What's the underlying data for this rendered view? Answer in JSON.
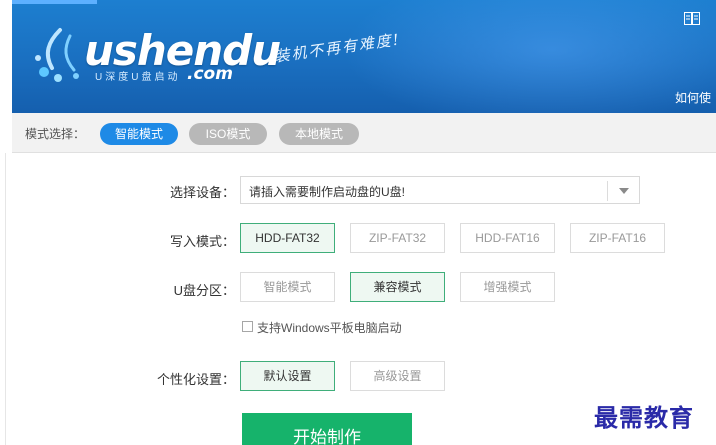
{
  "header": {
    "logo_word": "ushendu",
    "logo_sub": "U深度U盘启动",
    "logo_com": ".com",
    "slogan": "装机不再有难度!",
    "help_link": "如何使"
  },
  "mode_bar": {
    "label": "模式选择：",
    "modes": [
      {
        "label": "智能模式",
        "active": true
      },
      {
        "label": "ISO模式",
        "active": false
      },
      {
        "label": "本地模式",
        "active": false
      }
    ]
  },
  "form": {
    "device": {
      "label": "选择设备：",
      "placeholder": "请插入需要制作启动盘的U盘!"
    },
    "write_mode": {
      "label": "写入模式：",
      "options": [
        "HDD-FAT32",
        "ZIP-FAT32",
        "HDD-FAT16",
        "ZIP-FAT16"
      ],
      "selected": "HDD-FAT32"
    },
    "partition": {
      "label": "U盘分区：",
      "options": [
        "智能模式",
        "兼容模式",
        "增强模式"
      ],
      "selected": "兼容模式"
    },
    "windows_tablet": {
      "label": "支持Windows平板电脑启动",
      "checked": false
    },
    "personalize": {
      "label": "个性化设置：",
      "options": [
        "默认设置",
        "高级设置"
      ],
      "selected": "默认设置"
    },
    "start_button": "开始制作"
  },
  "watermark": "最需教育",
  "colors": {
    "header_blue": "#1a6fc0",
    "accent_blue": "#1e8ae6",
    "selected_green": "#3fae7a",
    "start_green": "#16b36b"
  }
}
